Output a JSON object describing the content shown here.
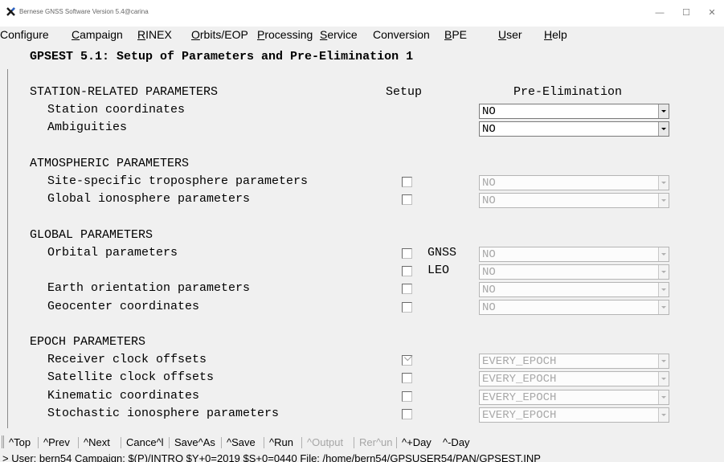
{
  "window": {
    "title": "Bernese GNSS Software Version 5.4@carina",
    "minimize_glyph": "—",
    "maximize_glyph": "☐",
    "close_glyph": "✕"
  },
  "menu": [
    "Configure",
    "Campaign",
    "RINEX",
    "Orbits/EOP",
    "Processing",
    "Service",
    "Conversion",
    "BPE",
    "User",
    "Help"
  ],
  "panel": {
    "title": "GPSEST 5.1: Setup of Parameters and Pre-Elimination 1",
    "col_setup": "Setup",
    "col_preelim": "Pre-Elimination",
    "sections": [
      {
        "title": "STATION-RELATED PARAMETERS",
        "rows": [
          {
            "label": "Station coordinates",
            "checkbox": null,
            "sys": "",
            "value": "NO",
            "enabled": true
          },
          {
            "label": "Ambiguities",
            "checkbox": null,
            "sys": "",
            "value": "NO",
            "enabled": true
          }
        ]
      },
      {
        "title": "ATMOSPHERIC PARAMETERS",
        "rows": [
          {
            "label": "Site-specific troposphere parameters",
            "checkbox": false,
            "sys": "",
            "value": "NO",
            "enabled": false
          },
          {
            "label": "Global ionosphere parameters",
            "checkbox": false,
            "sys": "",
            "value": "NO",
            "enabled": false
          }
        ]
      },
      {
        "title": "GLOBAL PARAMETERS",
        "rows": [
          {
            "label": "Orbital parameters",
            "checkbox": false,
            "sys": "GNSS",
            "value": "NO",
            "enabled": false
          },
          {
            "label": "",
            "checkbox": false,
            "sys": "LEO",
            "value": "NO",
            "enabled": false
          },
          {
            "label": "Earth orientation parameters",
            "checkbox": false,
            "sys": "",
            "value": "NO",
            "enabled": false
          },
          {
            "label": "Geocenter coordinates",
            "checkbox": false,
            "sys": "",
            "value": "NO",
            "enabled": false
          }
        ]
      },
      {
        "title": "EPOCH PARAMETERS",
        "rows": [
          {
            "label": "Receiver clock offsets",
            "checkbox": true,
            "sys": "",
            "value": "EVERY_EPOCH",
            "enabled": false
          },
          {
            "label": "Satellite clock offsets",
            "checkbox": false,
            "sys": "",
            "value": "EVERY_EPOCH",
            "enabled": false
          },
          {
            "label": "Kinematic coordinates",
            "checkbox": false,
            "sys": "",
            "value": "EVERY_EPOCH",
            "enabled": false
          },
          {
            "label": "Stochastic ionosphere parameters",
            "checkbox": false,
            "sys": "",
            "value": "EVERY_EPOCH",
            "enabled": false
          }
        ]
      }
    ]
  },
  "toolbar": [
    {
      "label": "^Top",
      "enabled": true
    },
    {
      "label": "^Prev",
      "enabled": true
    },
    {
      "label": "^Next",
      "enabled": true
    },
    {
      "label": "Cance^l",
      "enabled": true
    },
    {
      "label": "Save^As",
      "enabled": true
    },
    {
      "label": "^Save",
      "enabled": true
    },
    {
      "label": "^Run",
      "enabled": true
    },
    {
      "label": "^Output",
      "enabled": false
    },
    {
      "label": "Rer^un",
      "enabled": false
    },
    {
      "label": "^+Day",
      "enabled": true
    },
    {
      "label": "^-Day",
      "enabled": true
    }
  ],
  "status": "> User: bern54  Campaign: $(P)/INTRO  $Y+0=2019  $S+0=0440  File: /home/bern54/GPSUSER54/PAN/GPSEST.INP"
}
